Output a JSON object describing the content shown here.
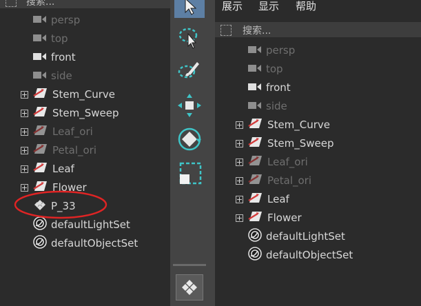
{
  "left_outliner": {
    "search_placeholder": "搜索...",
    "items": [
      {
        "label": "persp",
        "icon": "camera-icon",
        "dim": true,
        "expandable": false
      },
      {
        "label": "top",
        "icon": "camera-icon",
        "dim": true,
        "expandable": false
      },
      {
        "label": "front",
        "icon": "camera-icon",
        "dim": false,
        "expandable": false
      },
      {
        "label": "side",
        "icon": "camera-icon",
        "dim": true,
        "expandable": false
      },
      {
        "label": "Stem_Curve",
        "icon": "transform-icon",
        "dim": false,
        "expandable": true
      },
      {
        "label": "Stem_Sweep",
        "icon": "transform-icon",
        "dim": false,
        "expandable": true
      },
      {
        "label": "Leaf_ori",
        "icon": "transform-icon",
        "dim": true,
        "expandable": true
      },
      {
        "label": "Petal_ori",
        "icon": "transform-icon",
        "dim": true,
        "expandable": true
      },
      {
        "label": "Leaf",
        "icon": "transform-icon",
        "dim": false,
        "expandable": true
      },
      {
        "label": "Flower",
        "icon": "transform-icon",
        "dim": false,
        "expandable": true
      },
      {
        "label": "P_33",
        "icon": "mash-icon",
        "dim": false,
        "expandable": false
      },
      {
        "label": "defaultLightSet",
        "icon": "set-icon",
        "dim": false,
        "expandable": false
      },
      {
        "label": "defaultObjectSet",
        "icon": "set-icon",
        "dim": false,
        "expandable": false
      }
    ]
  },
  "right_outliner": {
    "menu": [
      "展示",
      "显示",
      "帮助"
    ],
    "search_placeholder": "搜索...",
    "items": [
      {
        "label": "persp",
        "icon": "camera-icon",
        "dim": true,
        "expandable": false
      },
      {
        "label": "top",
        "icon": "camera-icon",
        "dim": true,
        "expandable": false
      },
      {
        "label": "front",
        "icon": "camera-icon",
        "dim": false,
        "expandable": false
      },
      {
        "label": "side",
        "icon": "camera-icon",
        "dim": true,
        "expandable": false
      },
      {
        "label": "Stem_Curve",
        "icon": "transform-icon",
        "dim": false,
        "expandable": true
      },
      {
        "label": "Stem_Sweep",
        "icon": "transform-icon",
        "dim": false,
        "expandable": true
      },
      {
        "label": "Leaf_ori",
        "icon": "transform-icon",
        "dim": true,
        "expandable": true
      },
      {
        "label": "Petal_ori",
        "icon": "transform-icon",
        "dim": true,
        "expandable": true
      },
      {
        "label": "Leaf",
        "icon": "transform-icon",
        "dim": false,
        "expandable": true
      },
      {
        "label": "Flower",
        "icon": "transform-icon",
        "dim": false,
        "expandable": true
      },
      {
        "label": "defaultLightSet",
        "icon": "set-icon",
        "dim": false,
        "expandable": false
      },
      {
        "label": "defaultObjectSet",
        "icon": "set-icon",
        "dim": false,
        "expandable": false
      }
    ]
  },
  "toolbar": {
    "tools": [
      "select-arrow-icon",
      "lasso-select-icon",
      "paint-select-icon",
      "move-tool-icon",
      "rotate-tool-icon",
      "scale-tool-icon"
    ],
    "bottom_button_icon": "mash-icon"
  },
  "colors": {
    "panel_bg": "#2b2b2b",
    "toolbar_bg": "#444444",
    "active_tool": "#5d7fa4",
    "annotation": "#e02424",
    "transform_icon_red": "#d23b3b"
  }
}
